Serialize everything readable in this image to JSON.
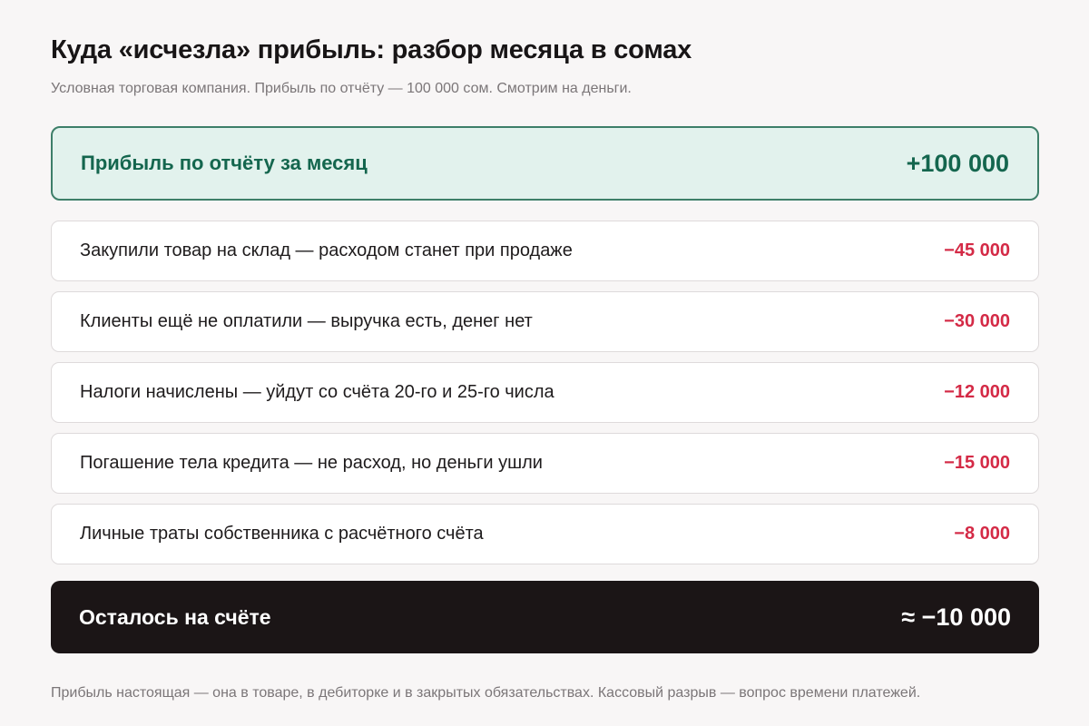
{
  "header": {
    "title": "Куда «исчезла» прибыль: разбор месяца в сомах",
    "subtitle": "Условная торговая компания. Прибыль по отчёту — 100 000 сом. Смотрим на деньги."
  },
  "profit": {
    "label": "Прибыль по отчёту за месяц",
    "value": "+100 000"
  },
  "deductions": [
    {
      "label": "Закупили товар на склад — расходом станет при продаже",
      "value": "−45 000"
    },
    {
      "label": "Клиенты ещё не оплатили — выручка есть, денег нет",
      "value": "−30 000"
    },
    {
      "label": "Налоги начислены — уйдут со счёта 20-го и 25-го числа",
      "value": "−12 000"
    },
    {
      "label": "Погашение тела кредита — не расход, но деньги ушли",
      "value": "−15 000"
    },
    {
      "label": "Личные траты собственника с расчётного счёта",
      "value": "−8 000"
    }
  ],
  "total": {
    "label": "Осталось на счёте",
    "value": "≈ −10 000"
  },
  "footnote": "Прибыль настоящая — она в товаре, в дебиторке и в закрытых обязательствах. Кассовый разрыв — вопрос времени платежей.",
  "colors": {
    "background": "#f8f6f6",
    "profit_accent": "#14664e",
    "profit_bg": "#e2f2ed",
    "negative": "#d42a46",
    "total_bg": "#1b1516"
  }
}
